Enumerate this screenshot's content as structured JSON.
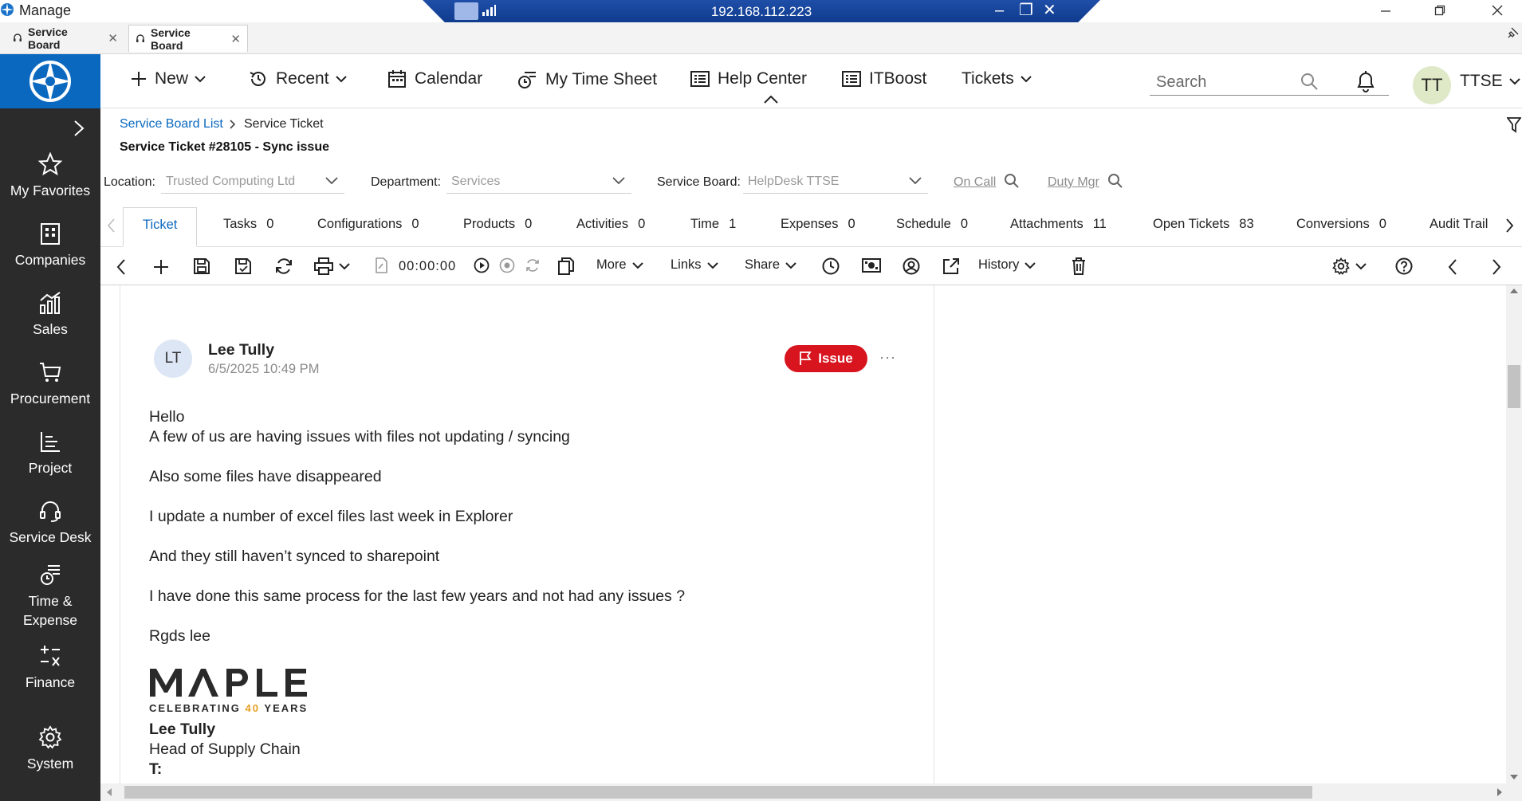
{
  "window": {
    "title": "Manage",
    "remote_ip": "192.168.112.223"
  },
  "browser_tabs": [
    {
      "label": "Service Board"
    },
    {
      "label": "Service Board"
    }
  ],
  "sidebar": {
    "items": [
      {
        "label": "My Favorites",
        "icon": "star-icon"
      },
      {
        "label": "Companies",
        "icon": "building-icon"
      },
      {
        "label": "Sales",
        "icon": "chart-icon"
      },
      {
        "label": "Procurement",
        "icon": "cart-icon"
      },
      {
        "label": "Project",
        "icon": "project-icon"
      },
      {
        "label": "Service Desk",
        "icon": "headset-icon"
      },
      {
        "label": "Time & Expense",
        "icon": "timesheet-icon"
      },
      {
        "label": "Finance",
        "icon": "calculator-icon"
      },
      {
        "label": "System",
        "icon": "gear-icon"
      }
    ]
  },
  "topnav": {
    "new": "New",
    "recent": "Recent",
    "calendar": "Calendar",
    "timesheet": "My Time Sheet",
    "helpcenter": "Help Center",
    "itboost": "ITBoost",
    "tickets": "Tickets",
    "search_placeholder": "Search",
    "user_initials": "TT",
    "user_name": "TTSE"
  },
  "breadcrumb": {
    "parent": "Service Board List",
    "current": "Service Ticket"
  },
  "ticket": {
    "title": "Service Ticket #28105 - Sync issue"
  },
  "fields": {
    "location_label": "Location:",
    "location_value": "Trusted Computing Ltd",
    "department_label": "Department:",
    "department_value": "Services",
    "board_label": "Service Board:",
    "board_value": "HelpDesk TTSE",
    "on_call": "On Call",
    "duty_mgr": "Duty Mgr"
  },
  "ticket_tabs": [
    {
      "label": "Ticket",
      "count": ""
    },
    {
      "label": "Tasks",
      "count": "0"
    },
    {
      "label": "Configurations",
      "count": "0"
    },
    {
      "label": "Products",
      "count": "0"
    },
    {
      "label": "Activities",
      "count": "0"
    },
    {
      "label": "Time",
      "count": "1"
    },
    {
      "label": "Expenses",
      "count": "0"
    },
    {
      "label": "Schedule",
      "count": "0"
    },
    {
      "label": "Attachments",
      "count": "11"
    },
    {
      "label": "Open Tickets",
      "count": "83"
    },
    {
      "label": "Conversions",
      "count": "0"
    },
    {
      "label": "Audit Trail",
      "count": ""
    }
  ],
  "toolbar": {
    "timer": "00:00:00",
    "more": "More",
    "links": "Links",
    "share": "Share",
    "history": "History"
  },
  "message": {
    "author_initials": "LT",
    "author": "Lee Tully",
    "date": "6/5/2025 10:49 PM",
    "badge": "Issue",
    "lines": [
      "Hello",
      "A few of us are having issues with files not updating / syncing",
      "Also some files have disappeared",
      "I update a number of excel files last week in Explorer",
      "And they still  haven’t synced to sharepoint",
      "I have done this same process for the last few years and not had any issues ?",
      "Rgds lee"
    ],
    "logo_text": "MAPLE",
    "tagline_pre": "CELEBRATING ",
    "tagline_num": "40",
    "tagline_post": " YEARS",
    "sig_name": "Lee Tully",
    "sig_title": "Head of Supply Chain",
    "sig_phone_label": "T:"
  },
  "colors": {
    "sidebar_bg": "#2b2b2b",
    "brand_blue": "#0a68bf",
    "issue_red": "#d8141f"
  }
}
